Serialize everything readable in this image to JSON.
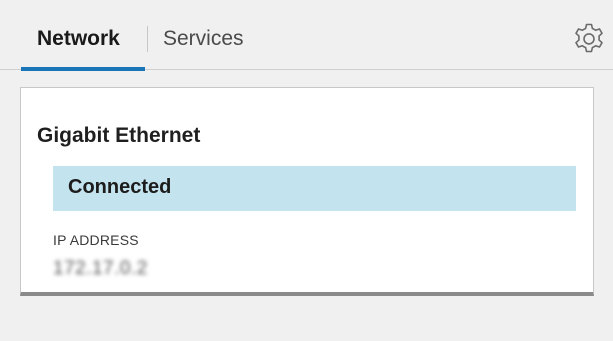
{
  "tabs": {
    "network_label": "Network",
    "services_label": "Services",
    "active": "Network",
    "accent_color": "#1a74b8"
  },
  "toolbar": {
    "settings_icon": "gear-icon"
  },
  "card": {
    "title": "Gigabit Ethernet",
    "status": "Connected",
    "status_color": "#c3e3ee",
    "ip_label": "IP ADDRESS",
    "ip_value": "172.17.0.2"
  }
}
